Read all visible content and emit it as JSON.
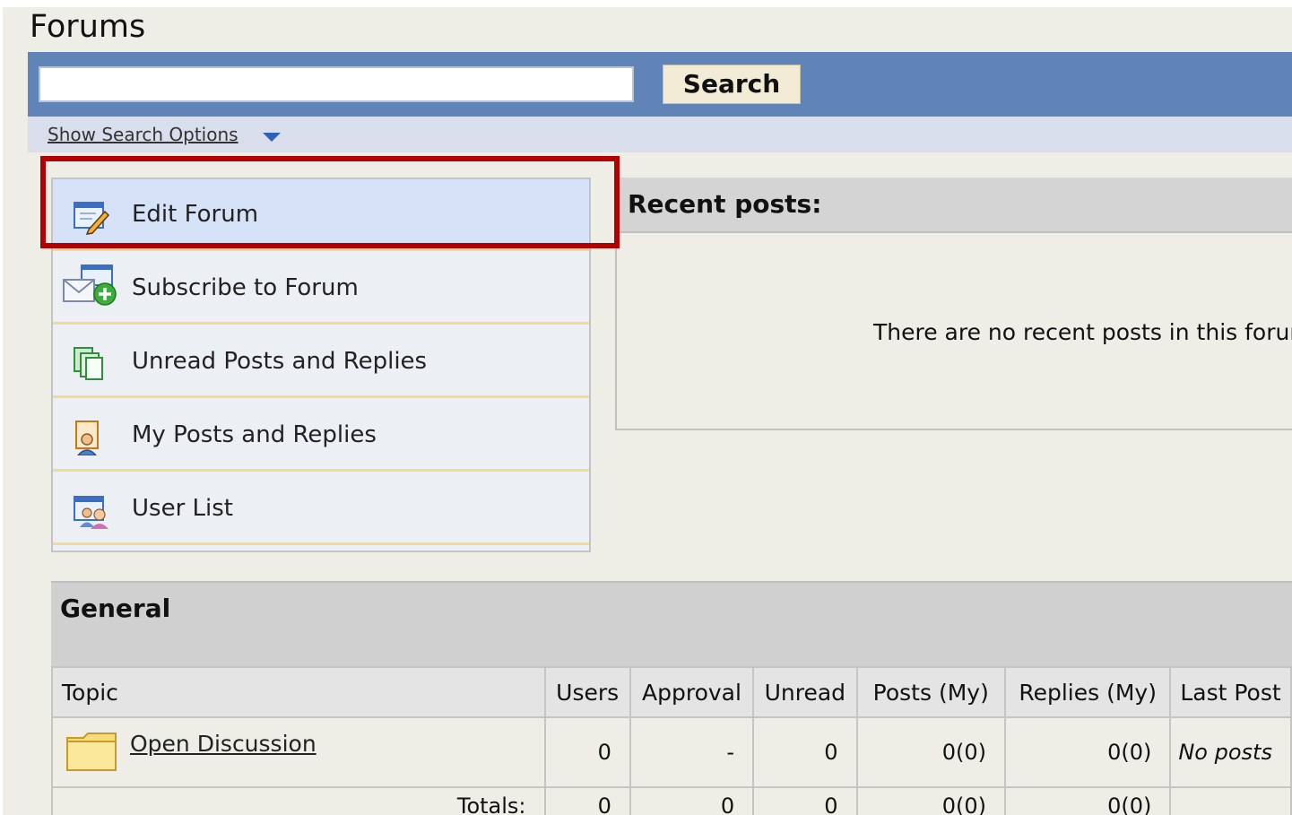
{
  "header": {
    "title": "Forums"
  },
  "search": {
    "value": "",
    "button_label": "Search",
    "options_label": "Show Search Options"
  },
  "menu": {
    "items": [
      {
        "label": "Edit Forum",
        "icon": "edit-forum-icon"
      },
      {
        "label": "Subscribe to Forum",
        "icon": "subscribe-icon"
      },
      {
        "label": "Unread Posts and Replies",
        "icon": "unread-posts-icon"
      },
      {
        "label": "My Posts and Replies",
        "icon": "my-posts-icon"
      },
      {
        "label": "User List",
        "icon": "user-list-icon"
      }
    ]
  },
  "recent": {
    "title": "Recent posts:",
    "empty_text": "There are no recent posts in this forum."
  },
  "general": {
    "title": "General",
    "columns": [
      "Topic",
      "Users",
      "Approval",
      "Unread",
      "Posts (My)",
      "Replies (My)",
      "Last Post"
    ],
    "rows": [
      {
        "topic": "Open Discussion",
        "users": "0",
        "approval": "-",
        "unread": "0",
        "posts": "0(0)",
        "replies": "0(0)",
        "last": "No posts"
      }
    ],
    "totals": {
      "label": "Totals:",
      "users": "0",
      "approval": "0",
      "unread": "0",
      "posts": "0(0)",
      "replies": "0(0)"
    }
  },
  "colors": {
    "search_bar": "#6184b8",
    "highlight": "#b40000",
    "menu_active": "#d6e2f8",
    "menu_separator": "#f0dc8c"
  }
}
